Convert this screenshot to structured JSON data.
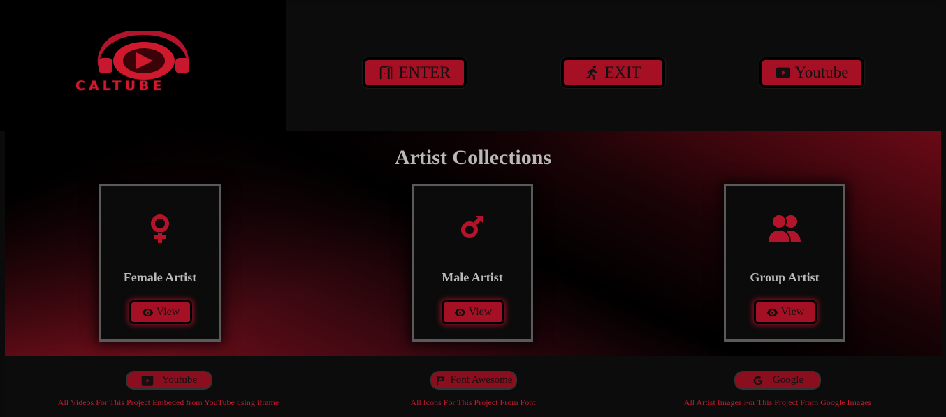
{
  "brand": {
    "name": "CALTUBE"
  },
  "nav": {
    "buttons": [
      {
        "label": "ENTER",
        "icon": "door-open-icon"
      },
      {
        "label": "EXIT",
        "icon": "running-person-icon"
      },
      {
        "label": "Youtube",
        "icon": "youtube-icon"
      }
    ]
  },
  "hero": {
    "title": "Artist Collections",
    "cards": [
      {
        "label": "Female Artist",
        "icon": "female-symbol-icon",
        "button": "View"
      },
      {
        "label": "Male Artist",
        "icon": "male-symbol-icon",
        "button": "View"
      },
      {
        "label": "Group Artist",
        "icon": "users-icon",
        "button": "View"
      }
    ]
  },
  "footer": {
    "credits": [
      {
        "button": "Youtube",
        "icon": "youtube-icon",
        "text": "All Videos For This Project Embeded from YouTube using iframe"
      },
      {
        "button": "Font Awesome",
        "icon": "font-awesome-flag-icon",
        "text": "All Icons For This Project From Font"
      },
      {
        "button": "Google",
        "icon": "google-icon",
        "text": "All Artist Images For This Project From Google Images"
      }
    ]
  },
  "colors": {
    "accent": "#a51025",
    "background": "#0b0b0b",
    "heading": "#b9b9b9",
    "credit_text": "#c21a2e"
  }
}
